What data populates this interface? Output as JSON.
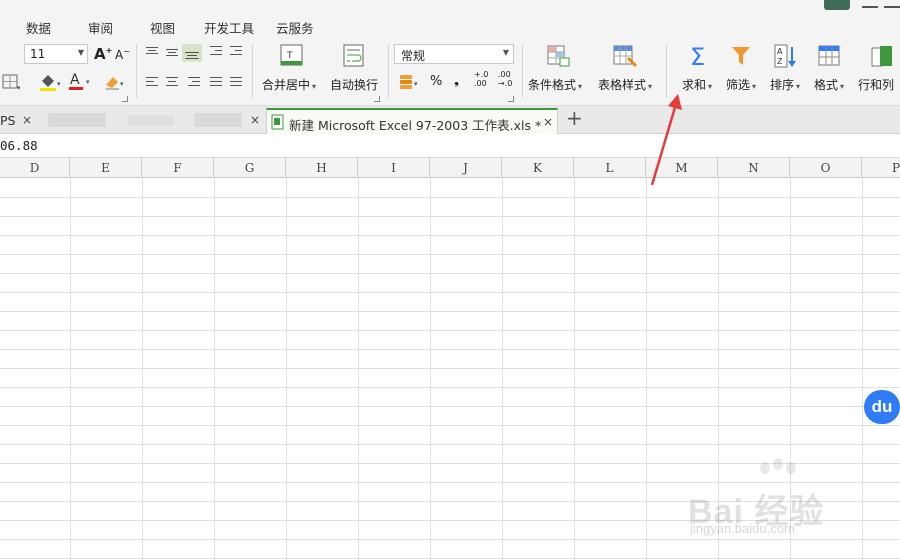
{
  "menu": {
    "tabs": [
      "数据",
      "审阅",
      "视图",
      "开发工具",
      "云服务"
    ]
  },
  "ribbon": {
    "font_size": "11",
    "number_format": "常规",
    "merge_center": "合并居中",
    "wrap_text": "自动换行",
    "percent_symbol": "%",
    "thousands_symbol": "❟",
    "decimal_increase": "+.0\n.00",
    "decimal_decrease": ".00\n→.0",
    "conditional_format": "条件格式",
    "table_style": "表格样式",
    "sum": "求和",
    "filter": "筛选",
    "sort": "排序",
    "format": "格式",
    "rows_cols": "行和列",
    "grow_font": "A",
    "shrink_font": "A",
    "font_color_letter": "A",
    "sort_icon_letters": "AZ"
  },
  "tabs": {
    "left_fragment": "PS",
    "active_tab": "新建 Microsoft Excel 97-2003 工作表.xls *",
    "close_symbol": "×",
    "new_tab_symbol": "+"
  },
  "formula": {
    "value": "06.88"
  },
  "columns": [
    "D",
    "E",
    "F",
    "G",
    "H",
    "I",
    "J",
    "K",
    "L",
    "M",
    "N",
    "O",
    "P"
  ],
  "overlay": {
    "badge": "du",
    "watermark": "Bai 经验",
    "watermark_url": "jingyan.baidu.com"
  },
  "colors": {
    "accent_green": "#3c9a3c",
    "sum_blue": "#2f7cf6",
    "filter_orange": "#f0962b",
    "arrow_red": "#e53b3b"
  }
}
